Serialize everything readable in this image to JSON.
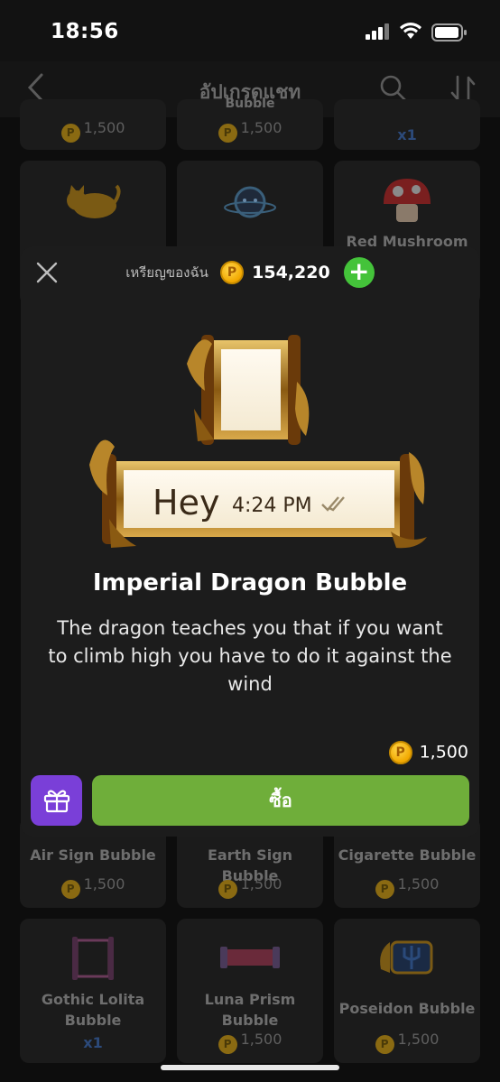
{
  "status_bar": {
    "time": "18:56"
  },
  "nav": {
    "title": "อัปเกรดแชท"
  },
  "grid": {
    "row0": [
      {
        "price": "1,500"
      },
      {
        "name_partial": "Bubble",
        "price": "1,500"
      },
      {
        "qty": "x1"
      }
    ],
    "row1": [
      {
        "thumb": "cat-sticker"
      },
      {
        "thumb": "planet-sticker"
      },
      {
        "name": "Red Mushroom",
        "thumb": "mushroom-sticker"
      }
    ],
    "row2": [
      {
        "name": "Air Sign Bubble",
        "price": "1,500"
      },
      {
        "name": "Earth Sign Bubble",
        "price": "1,500"
      },
      {
        "name": "Cigarette Bubble",
        "price": "1,500"
      }
    ],
    "row3": [
      {
        "name": "Gothic Lolita Bubble",
        "qty": "x1"
      },
      {
        "name": "Luna Prism Bubble",
        "price": "1,500"
      },
      {
        "name": "Poseidon Bubble",
        "price": "1,500"
      }
    ],
    "coin_letter": "P"
  },
  "modal": {
    "balance_label": "เหรียญของฉัน",
    "balance_amount": "154,220",
    "coin_letter": "P",
    "preview": {
      "message": "Hey",
      "time": "4:24 PM"
    },
    "title": "Imperial Dragon Bubble",
    "description": "The dragon teaches you that if you want to climb high you have to do it against the wind",
    "price": "1,500",
    "buy_label": "ซื้อ"
  },
  "colors": {
    "accent_green": "#6fae3a",
    "gift_purple": "#7a3fd8",
    "coin_gold": "#f2a800",
    "plus_green": "#44c33a"
  }
}
